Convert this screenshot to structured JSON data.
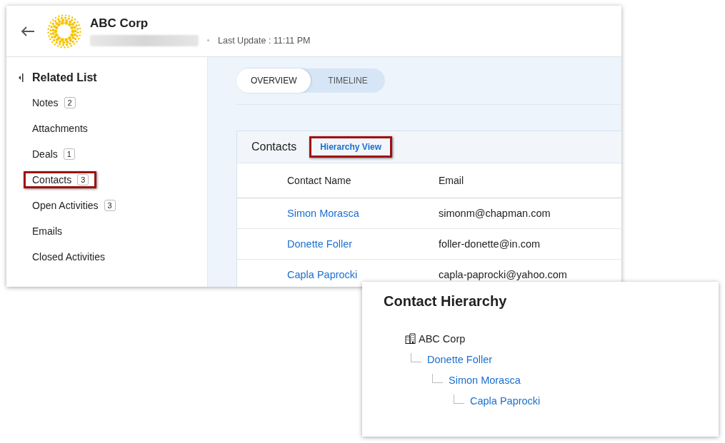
{
  "record": {
    "title": "ABC Corp",
    "last_update": "Last Update : 11:11 PM"
  },
  "sidebar": {
    "title": "Related List",
    "items": [
      {
        "label": "Notes",
        "count": "2",
        "highlighted": false
      },
      {
        "label": "Attachments",
        "highlighted": false
      },
      {
        "label": "Deals",
        "count": "1",
        "highlighted": false
      },
      {
        "label": "Contacts",
        "count": "3",
        "highlighted": true
      },
      {
        "label": "Open Activities",
        "count": "3",
        "highlighted": false
      },
      {
        "label": "Emails",
        "highlighted": false
      },
      {
        "label": "Closed Activities",
        "highlighted": false
      }
    ]
  },
  "tabs": [
    {
      "label": "OVERVIEW",
      "selected": true
    },
    {
      "label": "TIMELINE",
      "selected": false
    }
  ],
  "contacts": {
    "title": "Contacts",
    "hierarchy_link": {
      "label": "Hierarchy View",
      "highlighted": true
    },
    "columns": [
      "Contact Name",
      "Email"
    ],
    "rows": [
      {
        "name": "Simon Morasca",
        "email": "simonm@chapman.com"
      },
      {
        "name": "Donette Foller",
        "email": "foller-donette@in.com"
      },
      {
        "name": "Capla Paprocki",
        "email": "capla-paprocki@yahoo.com"
      }
    ]
  },
  "hierarchy": {
    "title": "Contact Hierarchy",
    "tree": [
      {
        "label": "ABC Corp",
        "kind": "company",
        "children": [
          {
            "label": "Donette Foller",
            "kind": "contact",
            "children": [
              {
                "label": "Simon Morasca",
                "kind": "contact",
                "children": [
                  {
                    "label": "Capla Paprocki",
                    "kind": "contact"
                  }
                ]
              }
            ]
          }
        ]
      }
    ]
  }
}
